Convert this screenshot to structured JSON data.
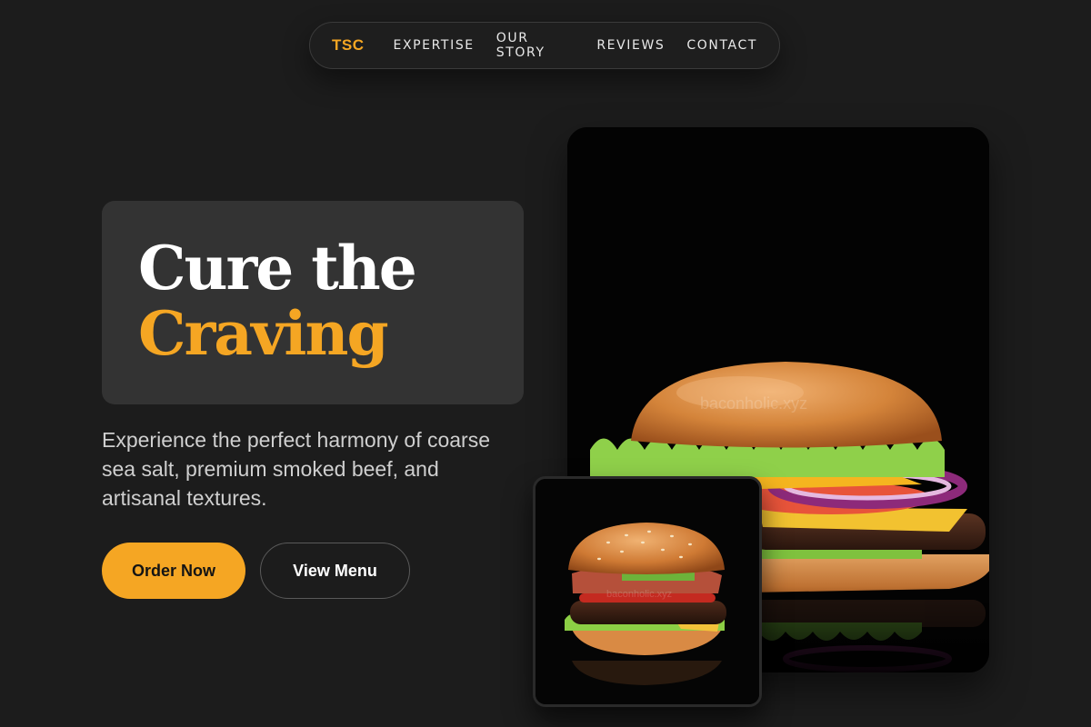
{
  "nav": {
    "logo": "TSC",
    "links": [
      "EXPERTISE",
      "OUR STORY",
      "REVIEWS",
      "CONTACT"
    ]
  },
  "hero": {
    "headline_line1": "Cure the",
    "headline_line2": "Craving",
    "subtitle": "Experience the perfect harmony of coarse sea salt, premium smoked beef, and artisanal textures.",
    "primary_button": "Order Now",
    "secondary_button": "View Menu"
  },
  "images": {
    "main_watermark": "baconholic.xyz",
    "thumb_watermark": "baconholic.xyz"
  },
  "colors": {
    "background": "#1c1c1c",
    "accent": "#f5a623",
    "card": "#333333"
  }
}
